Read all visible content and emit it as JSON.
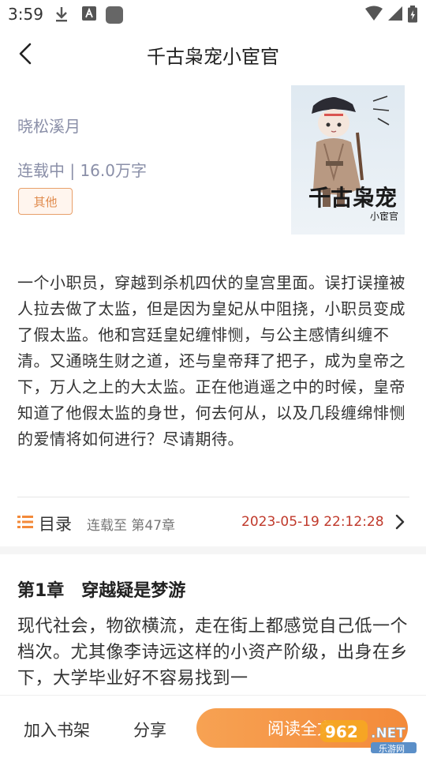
{
  "status_bar": {
    "time": "3:59"
  },
  "header": {
    "title": "千古枭宠小宦官"
  },
  "book": {
    "author": "晓松溪月",
    "status_line": "连载中 | 16.0万字",
    "tag": "其他",
    "cover_title": "千古枭宠",
    "cover_subtitle": "小宦官"
  },
  "description": "一个小职员，穿越到杀机四伏的皇宫里面。误打误撞被人拉去做了太监，但是因为皇妃从中阻挠，小职员变成了假太监。他和宫廷皇妃缠悱恻，与公主感情纠缠不清。又通晓生财之道，还与皇帝拜了把子，成为皇帝之下，万人之上的大太监。正在他逍遥之中的时候，皇帝知道了他假太监的身世，何去何从，以及几段缠绵悱恻的爱情将如何进行？尽请期待。",
  "catalog": {
    "label": "目录",
    "latest": "连载至 第47章",
    "update_time": "2023-05-19 22:12:28"
  },
  "chapter": {
    "title": "第1章　穿越疑是梦游",
    "text": "现代社会，物欲横流，走在街上都感觉自己低一个档次。尤其像李诗远这样的小资产阶级，出身在乡下，大学毕业好不容易找到一"
  },
  "bottom_bar": {
    "add_shelf": "加入书架",
    "share": "分享",
    "read": "阅读全文"
  },
  "watermark": {
    "number": "962",
    "suffix": ".NET",
    "site": "乐游网"
  },
  "colors": {
    "accent": "#f38a3a",
    "time_red": "#c0392b",
    "muted": "#8a8fa8"
  }
}
